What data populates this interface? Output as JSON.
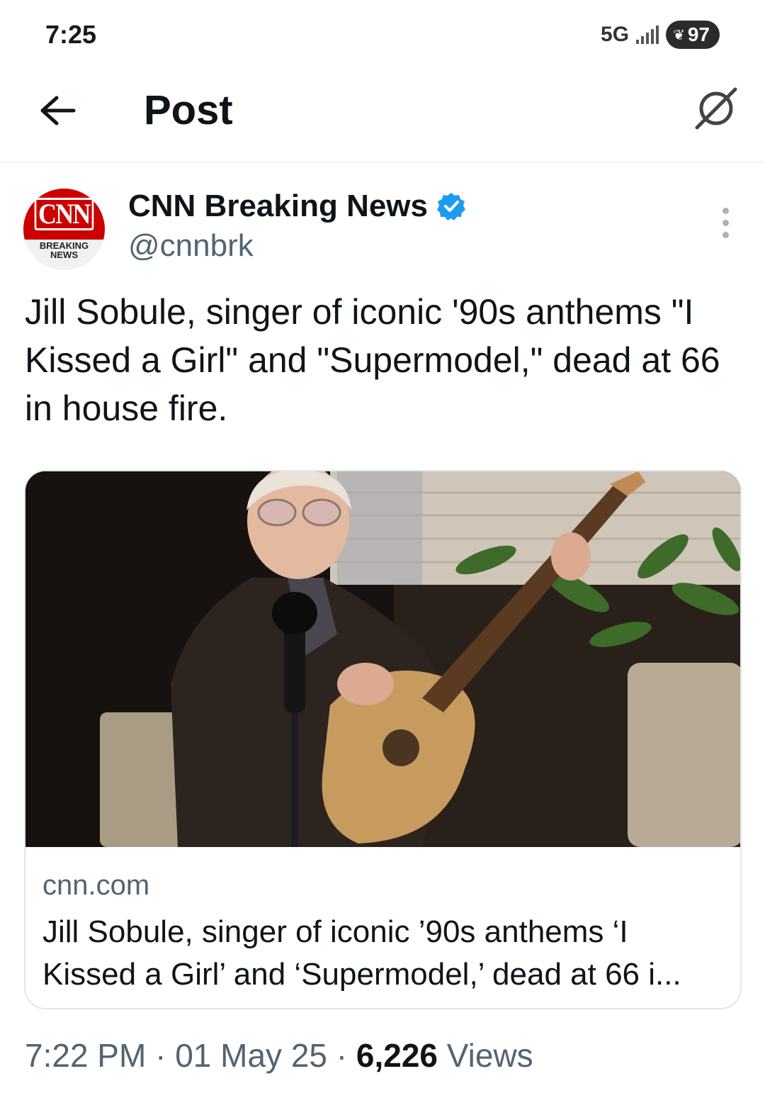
{
  "status_bar": {
    "time": "7:25",
    "network": "5G",
    "battery": "97"
  },
  "header": {
    "title": "Post",
    "back_icon": "arrow-left-icon",
    "grok_icon": "grok-icon"
  },
  "post": {
    "author_name": "CNN Breaking News",
    "author_handle": "@cnnbrk",
    "avatar_logo": "CNN",
    "avatar_sub": "BREAKING NEWS",
    "verified_color": "#1d9bf0",
    "text": "Jill Sobule, singer of iconic '90s anthems \"I Kissed a Girl\" and \"Supermodel,\" dead at 66 in house fire.",
    "card": {
      "domain": "cnn.com",
      "title": "Jill Sobule, singer of iconic ’90s anthems ‘I Kissed a Girl’ and ‘Supermodel,’ dead at 66 i..."
    },
    "time": "7:22 PM",
    "separator": "·",
    "date": "01 May 25",
    "views_count": "6,226",
    "views_label": "Views"
  }
}
